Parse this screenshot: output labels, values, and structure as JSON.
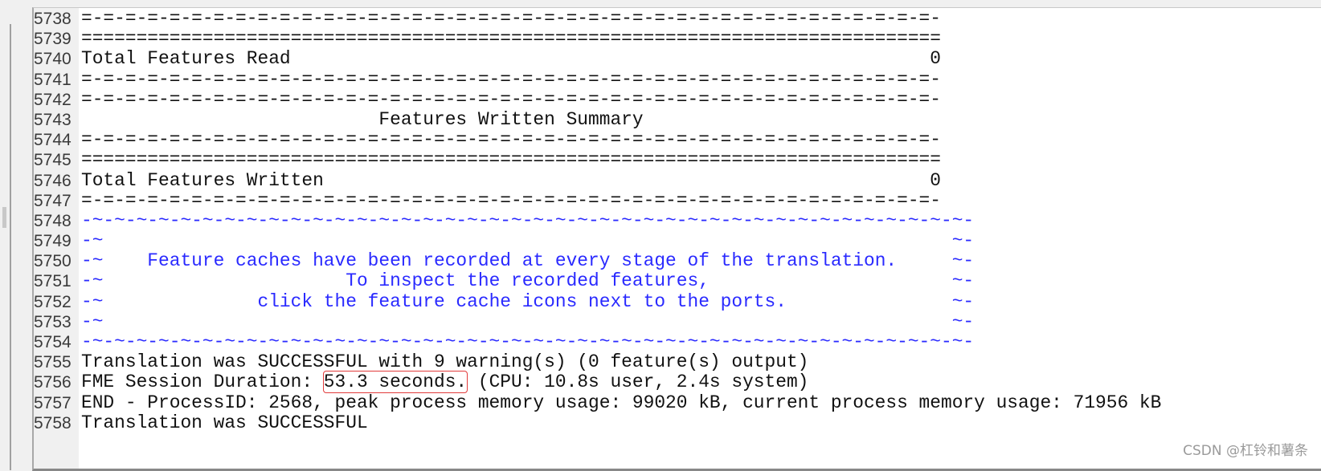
{
  "watermark": "CSDN @杠铃和薯条",
  "colors": {
    "text": "#111111",
    "blue": "#2a2aff",
    "highlight": "#e23b3b",
    "gutter": "#f0f0f0"
  },
  "lines": [
    {
      "num": "5738",
      "text": "=-=-=-=-=-=-=-=-=-=-=-=-=-=-=-=-=-=-=-=-=-=-=-=-=-=-=-=-=-=-=-=-=-=-=-=-=-=-=-"
    },
    {
      "num": "5739",
      "text": "=============================================================================="
    },
    {
      "num": "5740",
      "label": "Total Features Read",
      "value": "0"
    },
    {
      "num": "5741",
      "text": "=-=-=-=-=-=-=-=-=-=-=-=-=-=-=-=-=-=-=-=-=-=-=-=-=-=-=-=-=-=-=-=-=-=-=-=-=-=-=-"
    },
    {
      "num": "5742",
      "text": "=-=-=-=-=-=-=-=-=-=-=-=-=-=-=-=-=-=-=-=-=-=-=-=-=-=-=-=-=-=-=-=-=-=-=-=-=-=-=-"
    },
    {
      "num": "5743",
      "text": "                           Features Written Summary"
    },
    {
      "num": "5744",
      "text": "=-=-=-=-=-=-=-=-=-=-=-=-=-=-=-=-=-=-=-=-=-=-=-=-=-=-=-=-=-=-=-=-=-=-=-=-=-=-=-"
    },
    {
      "num": "5745",
      "text": "=============================================================================="
    },
    {
      "num": "5746",
      "label": "Total Features Written",
      "value": "0"
    },
    {
      "num": "5747",
      "text": "=-=-=-=-=-=-=-=-=-=-=-=-=-=-=-=-=-=-=-=-=-=-=-=-=-=-=-=-=-=-=-=-=-=-=-=-=-=-=-"
    },
    {
      "num": "5748",
      "text": "-~-~-~-~-~-~-~-~-~-~-~-~-~-~-~-~-~-~-~-~-~-~-~-~-~-~-~-~-~-~-~-~-~-~-~-~-~-~-~-~-"
    },
    {
      "num": "5749",
      "left": "-~",
      "text": "",
      "right": "~-"
    },
    {
      "num": "5750",
      "left": "-~",
      "text": "    Feature caches have been recorded at every stage of the translation.",
      "right": "~-"
    },
    {
      "num": "5751",
      "left": "-~",
      "text": "                      To inspect the recorded features,",
      "right": "~-"
    },
    {
      "num": "5752",
      "left": "-~",
      "text": "              click the feature cache icons next to the ports.",
      "right": "~-"
    },
    {
      "num": "5753",
      "left": "-~",
      "text": "",
      "right": "~-"
    },
    {
      "num": "5754",
      "text": "-~-~-~-~-~-~-~-~-~-~-~-~-~-~-~-~-~-~-~-~-~-~-~-~-~-~-~-~-~-~-~-~-~-~-~-~-~-~-~-~-"
    },
    {
      "num": "5755",
      "text": "Translation was SUCCESSFUL with 9 warning(s) (0 feature(s) output)"
    },
    {
      "num": "5756",
      "before": "FME Session Duration: ",
      "highlight": "53.3 seconds.",
      "after": " (CPU: 10.8s user, 2.4s system)"
    },
    {
      "num": "5757",
      "text": "END - ProcessID: 2568, peak process memory usage: 99020 kB, current process memory usage: 71956 kB"
    },
    {
      "num": "5758",
      "text": "Translation was SUCCESSFUL"
    }
  ]
}
